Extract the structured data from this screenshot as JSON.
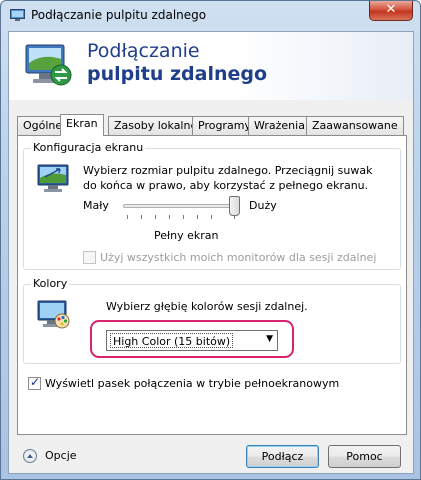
{
  "window": {
    "title": "Podłączanie pulpitu zdalnego",
    "close_symbol": "✕"
  },
  "banner": {
    "line1": "Podłączanie",
    "line2": "pulpitu zdalnego",
    "icon": "remote-desktop-icon"
  },
  "tabs": [
    {
      "label": "Ogólne",
      "active": false
    },
    {
      "label": "Ekran",
      "active": true
    },
    {
      "label": "Zasoby lokalne",
      "active": false
    },
    {
      "label": "Programy",
      "active": false
    },
    {
      "label": "Wrażenia",
      "active": false
    },
    {
      "label": "Zaawansowane",
      "active": false
    }
  ],
  "display_config": {
    "group_label": "Konfiguracja ekranu",
    "description": "Wybierz rozmiar pulpitu zdalnego. Przeciągnij suwak do końca w prawo, aby korzystać z pełnego ekranu.",
    "slider_min_label": "Mały",
    "slider_max_label": "Duży",
    "slider_value": 1.0,
    "size_value": "Pełny ekran",
    "multi_monitor_label": "Użyj wszystkich moich monitorów dla sesji zdalnej",
    "multi_monitor_checked": false,
    "multi_monitor_enabled": false
  },
  "colors": {
    "group_label": "Kolory",
    "description": "Wybierz głębię kolorów sesji zdalnej.",
    "selected_depth": "High Color (15 bitów)",
    "highlight_color": "#d6246f"
  },
  "connection_bar": {
    "label": "Wyświetl pasek połączenia w trybie pełnoekranowym",
    "checked": true
  },
  "footer": {
    "options_label": "Opcje",
    "connect_label": "Podłącz",
    "help_label": "Pomoc"
  }
}
